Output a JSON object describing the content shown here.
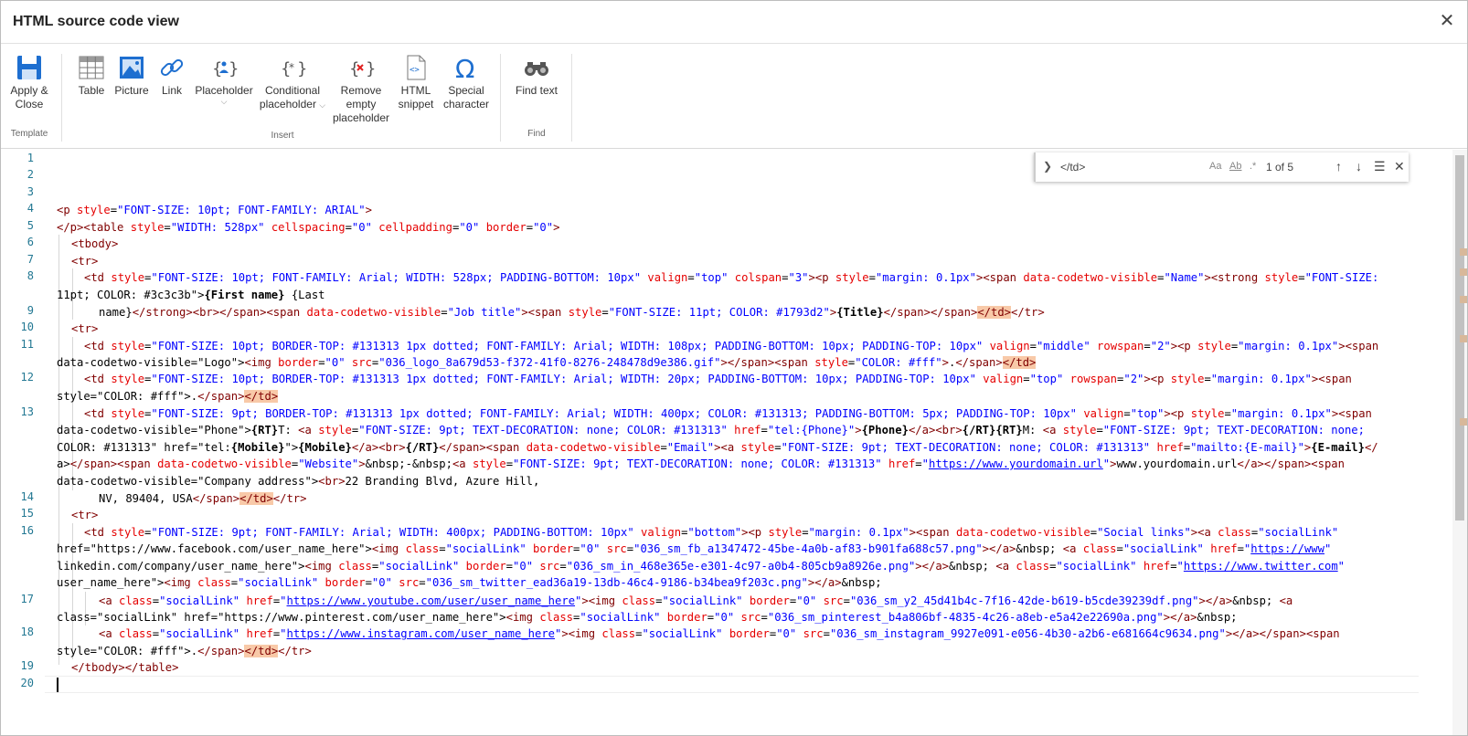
{
  "window": {
    "title": "HTML source code view",
    "close_label": "✕"
  },
  "ribbon": {
    "groups": [
      {
        "name": "Template",
        "buttons": [
          {
            "label": "Apply &",
            "label2": "Close"
          }
        ]
      },
      {
        "name": "Insert",
        "buttons": [
          {
            "label": "Table"
          },
          {
            "label": "Picture"
          },
          {
            "label": "Link"
          },
          {
            "label": "Placeholder",
            "caret": "⌵"
          },
          {
            "label": "Conditional",
            "label2": "placeholder",
            "caret": "⌵"
          },
          {
            "label": "Remove",
            "label2": "empty",
            "label3": "placeholder"
          },
          {
            "label": "HTML",
            "label2": "snippet"
          },
          {
            "label": "Special",
            "label2": "character"
          }
        ]
      },
      {
        "name": "Find",
        "buttons": [
          {
            "label": "Find text"
          }
        ]
      }
    ]
  },
  "find_widget": {
    "query": "</td>",
    "match_case": "Aa",
    "whole_word": "Ab",
    "regex": ".*",
    "count": "1 of 5"
  },
  "editor": {
    "line_numbers": [
      "1",
      "2",
      "3",
      "4",
      "5",
      "6",
      "7",
      "8",
      "9",
      "10",
      "11",
      "12",
      "13",
      "14",
      "15",
      "16",
      "17",
      "18",
      "19",
      "20"
    ],
    "lines": [
      "<p style=\"FONT-SIZE: 10pt; FONT-FAMILY: ARIAL\">",
      "</p><table style=\"WIDTH: 528px\" cellspacing=\"0\" cellpadding=\"0\" border=\"0\">",
      "<tbody>",
      "<tr>",
      "<td style=\"FONT-SIZE: 10pt; FONT-FAMILY: Arial; WIDTH: 528px; PADDING-BOTTOM: 10px\" valign=\"top\" colspan=\"3\"><p style=\"margin: 0.1px\"><span data-codetwo-visible=\"Name\"><strong style=\"FONT-SIZE:",
      "11pt; COLOR: #3c3c3b\">{First name} {Last",
      "name}</strong><br></span><span data-codetwo-visible=\"Job title\"><span style=\"FONT-SIZE: 11pt; COLOR: #1793d2\">{Title}</span></span></td></tr>",
      "<tr>",
      "<td style=\"FONT-SIZE: 10pt; BORDER-TOP: #131313 1px dotted; FONT-FAMILY: Arial; WIDTH: 108px; PADDING-BOTTOM: 10px; PADDING-TOP: 10px\" valign=\"middle\" rowspan=\"2\"><p style=\"margin: 0.1px\"><span",
      "data-codetwo-visible=\"Logo\"><img border=\"0\" src=\"036_logo_8a679d53-f372-41f0-8276-248478d9e386.gif\"></span><span style=\"COLOR: #fff\">.</span></td>",
      "<td style=\"FONT-SIZE: 10pt; BORDER-TOP: #131313 1px dotted; FONT-FAMILY: Arial; WIDTH: 20px; PADDING-BOTTOM: 10px; PADDING-TOP: 10px\" valign=\"top\" rowspan=\"2\"><p style=\"margin: 0.1px\"><span",
      "style=\"COLOR: #fff\">.</span></td>",
      "<td style=\"FONT-SIZE: 9pt; BORDER-TOP: #131313 1px dotted; FONT-FAMILY: Arial; WIDTH: 400px; COLOR: #131313; PADDING-BOTTOM: 5px; PADDING-TOP: 10px\" valign=\"top\"><p style=\"margin: 0.1px\"><span",
      "data-codetwo-visible=\"Phone\">{RT}T: <a style=\"FONT-SIZE: 9pt; TEXT-DECORATION: none; COLOR: #131313\" href=\"tel:{Phone}\">{Phone}</a><br>{/RT}{RT}M: <a style=\"FONT-SIZE: 9pt; TEXT-DECORATION: none;",
      "COLOR: #131313\" href=\"tel:{Mobile}\">{Mobile}</a><br>{/RT}</span><span data-codetwo-visible=\"Email\"><a style=\"FONT-SIZE: 9pt; TEXT-DECORATION: none; COLOR: #131313\" href=\"mailto:{E-mail}\">{E-mail}</",
      "a></span><span data-codetwo-visible=\"Website\">&nbsp;-&nbsp;<a style=\"FONT-SIZE: 9pt; TEXT-DECORATION: none; COLOR: #131313\" href=\"https://www.yourdomain.url\">www.yourdomain.url</a></span><span",
      "data-codetwo-visible=\"Company address\"><br>22 Branding Blvd, Azure Hill,",
      "NV, 89404, USA</span></td></tr>",
      "<tr>",
      "<td style=\"FONT-SIZE: 9pt; FONT-FAMILY: Arial; WIDTH: 400px; PADDING-BOTTOM: 10px\" valign=\"bottom\"><p style=\"margin: 0.1px\"><span data-codetwo-visible=\"Social links\"><a class=\"socialLink\"",
      "href=\"https://www.facebook.com/user_name_here\"><img class=\"socialLink\" border=\"0\" src=\"036_sm_fb_a1347472-45be-4a0b-af83-b901fa688c57.png\"></a>&nbsp; <a class=\"socialLink\" href=\"https://www.",
      "linkedin.com/company/user_name_here\"><img class=\"socialLink\" border=\"0\" src=\"036_sm_in_468e365e-e301-4c97-a0b4-805cb9a8926e.png\"></a>&nbsp; <a class=\"socialLink\" href=\"https://www.twitter.com/",
      "user_name_here\"><img class=\"socialLink\" border=\"0\" src=\"036_sm_twitter_ead36a19-13db-46c4-9186-b34bea9f203c.png\"></a>&nbsp;",
      "<a class=\"socialLink\" href=\"https://www.youtube.com/user/user_name_here\"><img class=\"socialLink\" border=\"0\" src=\"036_sm_y2_45d41b4c-7f16-42de-b619-b5cde39239df.png\"></a>&nbsp; <a",
      "class=\"socialLink\" href=\"https://www.pinterest.com/user_name_here\"><img class=\"socialLink\" border=\"0\" src=\"036_sm_pinterest_b4a806bf-4835-4c26-a8eb-e5a42e22690a.png\"></a>&nbsp;",
      "<a class=\"socialLink\" href=\"https://www.instagram.com/user_name_here\"><img class=\"socialLink\" border=\"0\" src=\"036_sm_instagram_9927e091-e056-4b30-a2b6-e681664c9634.png\"></a></span><span",
      "style=\"COLOR: #fff\">.</span></td></tr>",
      "</tbody></table>"
    ]
  }
}
